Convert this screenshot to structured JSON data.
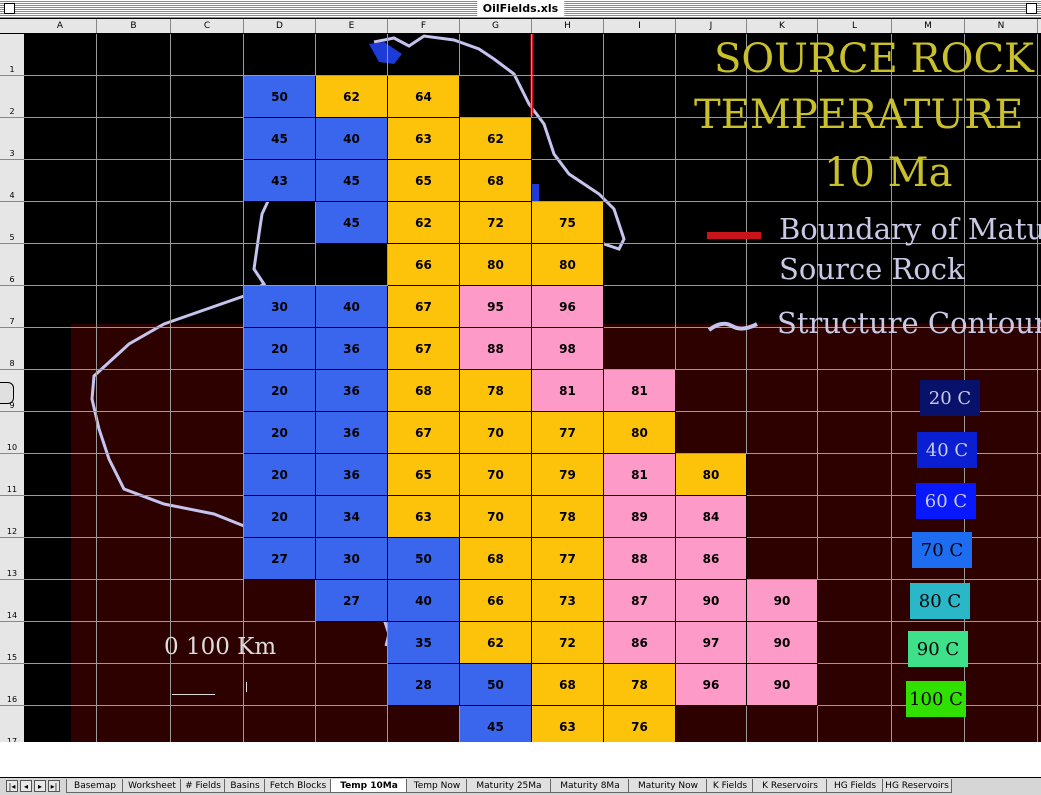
{
  "window": {
    "title": "OilFields.xls"
  },
  "columns": [
    "A",
    "B",
    "C",
    "D",
    "E",
    "F",
    "G",
    "H",
    "I",
    "J",
    "K",
    "L",
    "M",
    "N"
  ],
  "rows": [
    "1",
    "2",
    "3",
    "4",
    "5",
    "6",
    "7",
    "8",
    "9",
    "10",
    "11",
    "12",
    "13",
    "14",
    "15",
    "16",
    "17"
  ],
  "slide": {
    "title_lines": [
      "SOURCE ROCK",
      "TEMPERATURE",
      "10 Ma"
    ],
    "legend_boundary_line1": "Boundary of Matu",
    "legend_boundary_line2": "Source Rock",
    "legend_structure": "Structure Contour",
    "scale_label": "0      100 Km"
  },
  "temperature_legend": [
    {
      "label": "20 C",
      "color": "#08126b",
      "text_color": "#c9c9e6"
    },
    {
      "label": "40 C",
      "color": "#0a1fd1",
      "text_color": "#c9c9e6"
    },
    {
      "label": "60 C",
      "color": "#0818ff",
      "text_color": "#c9c9e6"
    },
    {
      "label": "70 C",
      "color": "#1e6df0",
      "text_color": "#000000"
    },
    {
      "label": "80 C",
      "color": "#2ab7c8",
      "text_color": "#000000"
    },
    {
      "label": "90 C",
      "color": "#3ee08a",
      "text_color": "#000000"
    },
    {
      "label": "100 C",
      "color": "#2fe000",
      "text_color": "#000000"
    }
  ],
  "cell_colors": {
    "blue": "#3a66ee",
    "yellow": "#fdc20a",
    "pink": "#fd9ac8",
    "dark_red": "#2e0101",
    "black": "#000000",
    "boundary_red": "#c8141a",
    "contour": "#c4c4ee"
  },
  "cells": [
    {
      "col": 3,
      "row": 1,
      "value": "50",
      "color": "blue"
    },
    {
      "col": 4,
      "row": 1,
      "value": "62",
      "color": "yellow"
    },
    {
      "col": 5,
      "row": 1,
      "value": "64",
      "color": "yellow"
    },
    {
      "col": 3,
      "row": 2,
      "value": "45",
      "color": "blue"
    },
    {
      "col": 4,
      "row": 2,
      "value": "40",
      "color": "blue"
    },
    {
      "col": 5,
      "row": 2,
      "value": "63",
      "color": "yellow"
    },
    {
      "col": 6,
      "row": 2,
      "value": "62",
      "color": "yellow"
    },
    {
      "col": 3,
      "row": 3,
      "value": "43",
      "color": "blue"
    },
    {
      "col": 4,
      "row": 3,
      "value": "45",
      "color": "blue"
    },
    {
      "col": 5,
      "row": 3,
      "value": "65",
      "color": "yellow"
    },
    {
      "col": 6,
      "row": 3,
      "value": "68",
      "color": "yellow"
    },
    {
      "col": 4,
      "row": 4,
      "value": "45",
      "color": "blue"
    },
    {
      "col": 5,
      "row": 4,
      "value": "62",
      "color": "yellow"
    },
    {
      "col": 6,
      "row": 4,
      "value": "72",
      "color": "yellow"
    },
    {
      "col": 7,
      "row": 4,
      "value": "75",
      "color": "yellow"
    },
    {
      "col": 5,
      "row": 5,
      "value": "66",
      "color": "yellow"
    },
    {
      "col": 6,
      "row": 5,
      "value": "80",
      "color": "yellow"
    },
    {
      "col": 7,
      "row": 5,
      "value": "80",
      "color": "yellow"
    },
    {
      "col": 3,
      "row": 6,
      "value": "30",
      "color": "blue"
    },
    {
      "col": 4,
      "row": 6,
      "value": "40",
      "color": "blue"
    },
    {
      "col": 5,
      "row": 6,
      "value": "67",
      "color": "yellow"
    },
    {
      "col": 6,
      "row": 6,
      "value": "95",
      "color": "pink"
    },
    {
      "col": 7,
      "row": 6,
      "value": "96",
      "color": "pink"
    },
    {
      "col": 3,
      "row": 7,
      "value": "20",
      "color": "blue"
    },
    {
      "col": 4,
      "row": 7,
      "value": "36",
      "color": "blue"
    },
    {
      "col": 5,
      "row": 7,
      "value": "67",
      "color": "yellow"
    },
    {
      "col": 6,
      "row": 7,
      "value": "88",
      "color": "pink"
    },
    {
      "col": 7,
      "row": 7,
      "value": "98",
      "color": "pink"
    },
    {
      "col": 3,
      "row": 8,
      "value": "20",
      "color": "blue"
    },
    {
      "col": 4,
      "row": 8,
      "value": "36",
      "color": "blue"
    },
    {
      "col": 5,
      "row": 8,
      "value": "68",
      "color": "yellow"
    },
    {
      "col": 6,
      "row": 8,
      "value": "78",
      "color": "yellow"
    },
    {
      "col": 7,
      "row": 8,
      "value": "81",
      "color": "pink"
    },
    {
      "col": 8,
      "row": 8,
      "value": "81",
      "color": "pink"
    },
    {
      "col": 3,
      "row": 9,
      "value": "20",
      "color": "blue"
    },
    {
      "col": 4,
      "row": 9,
      "value": "36",
      "color": "blue"
    },
    {
      "col": 5,
      "row": 9,
      "value": "67",
      "color": "yellow"
    },
    {
      "col": 6,
      "row": 9,
      "value": "70",
      "color": "yellow"
    },
    {
      "col": 7,
      "row": 9,
      "value": "77",
      "color": "yellow"
    },
    {
      "col": 8,
      "row": 9,
      "value": "80",
      "color": "yellow"
    },
    {
      "col": 3,
      "row": 10,
      "value": "20",
      "color": "blue"
    },
    {
      "col": 4,
      "row": 10,
      "value": "36",
      "color": "blue"
    },
    {
      "col": 5,
      "row": 10,
      "value": "65",
      "color": "yellow"
    },
    {
      "col": 6,
      "row": 10,
      "value": "70",
      "color": "yellow"
    },
    {
      "col": 7,
      "row": 10,
      "value": "79",
      "color": "yellow"
    },
    {
      "col": 8,
      "row": 10,
      "value": "81",
      "color": "pink"
    },
    {
      "col": 9,
      "row": 10,
      "value": "80",
      "color": "yellow"
    },
    {
      "col": 3,
      "row": 11,
      "value": "20",
      "color": "blue"
    },
    {
      "col": 4,
      "row": 11,
      "value": "34",
      "color": "blue"
    },
    {
      "col": 5,
      "row": 11,
      "value": "63",
      "color": "yellow"
    },
    {
      "col": 6,
      "row": 11,
      "value": "70",
      "color": "yellow"
    },
    {
      "col": 7,
      "row": 11,
      "value": "78",
      "color": "yellow"
    },
    {
      "col": 8,
      "row": 11,
      "value": "89",
      "color": "pink"
    },
    {
      "col": 9,
      "row": 11,
      "value": "84",
      "color": "pink"
    },
    {
      "col": 3,
      "row": 12,
      "value": "27",
      "color": "blue"
    },
    {
      "col": 4,
      "row": 12,
      "value": "30",
      "color": "blue"
    },
    {
      "col": 5,
      "row": 12,
      "value": "50",
      "color": "blue"
    },
    {
      "col": 6,
      "row": 12,
      "value": "68",
      "color": "yellow"
    },
    {
      "col": 7,
      "row": 12,
      "value": "77",
      "color": "yellow"
    },
    {
      "col": 8,
      "row": 12,
      "value": "88",
      "color": "pink"
    },
    {
      "col": 9,
      "row": 12,
      "value": "86",
      "color": "pink"
    },
    {
      "col": 4,
      "row": 13,
      "value": "27",
      "color": "blue"
    },
    {
      "col": 5,
      "row": 13,
      "value": "40",
      "color": "blue"
    },
    {
      "col": 6,
      "row": 13,
      "value": "66",
      "color": "yellow"
    },
    {
      "col": 7,
      "row": 13,
      "value": "73",
      "color": "yellow"
    },
    {
      "col": 8,
      "row": 13,
      "value": "87",
      "color": "pink"
    },
    {
      "col": 9,
      "row": 13,
      "value": "90",
      "color": "pink"
    },
    {
      "col": 10,
      "row": 13,
      "value": "90",
      "color": "pink"
    },
    {
      "col": 5,
      "row": 14,
      "value": "35",
      "color": "blue"
    },
    {
      "col": 6,
      "row": 14,
      "value": "62",
      "color": "yellow"
    },
    {
      "col": 7,
      "row": 14,
      "value": "72",
      "color": "yellow"
    },
    {
      "col": 8,
      "row": 14,
      "value": "86",
      "color": "pink"
    },
    {
      "col": 9,
      "row": 14,
      "value": "97",
      "color": "pink"
    },
    {
      "col": 10,
      "row": 14,
      "value": "90",
      "color": "pink"
    },
    {
      "col": 5,
      "row": 15,
      "value": "28",
      "color": "blue"
    },
    {
      "col": 6,
      "row": 15,
      "value": "50",
      "color": "blue"
    },
    {
      "col": 7,
      "row": 15,
      "value": "68",
      "color": "yellow"
    },
    {
      "col": 8,
      "row": 15,
      "value": "78",
      "color": "yellow"
    },
    {
      "col": 9,
      "row": 15,
      "value": "96",
      "color": "pink"
    },
    {
      "col": 10,
      "row": 15,
      "value": "90",
      "color": "pink"
    },
    {
      "col": 6,
      "row": 16,
      "value": "45",
      "color": "blue"
    },
    {
      "col": 7,
      "row": 16,
      "value": "63",
      "color": "yellow"
    },
    {
      "col": 8,
      "row": 16,
      "value": "76",
      "color": "yellow"
    }
  ],
  "tabs": [
    {
      "label": "Basemap",
      "active": false
    },
    {
      "label": "Worksheet",
      "active": false
    },
    {
      "label": "# Fields",
      "active": false
    },
    {
      "label": "Basins",
      "active": false
    },
    {
      "label": "Fetch Blocks",
      "active": false
    },
    {
      "label": "Temp 10Ma",
      "active": true
    },
    {
      "label": "Temp Now",
      "active": false
    },
    {
      "label": "Maturity 25Ma",
      "active": false
    },
    {
      "label": "Maturity 8Ma",
      "active": false
    },
    {
      "label": "Maturity Now",
      "active": false
    },
    {
      "label": "K Fields",
      "active": false
    },
    {
      "label": "K Reservoirs",
      "active": false
    },
    {
      "label": "HG Fields",
      "active": false
    },
    {
      "label": "HG Reservoirs",
      "active": false
    }
  ]
}
